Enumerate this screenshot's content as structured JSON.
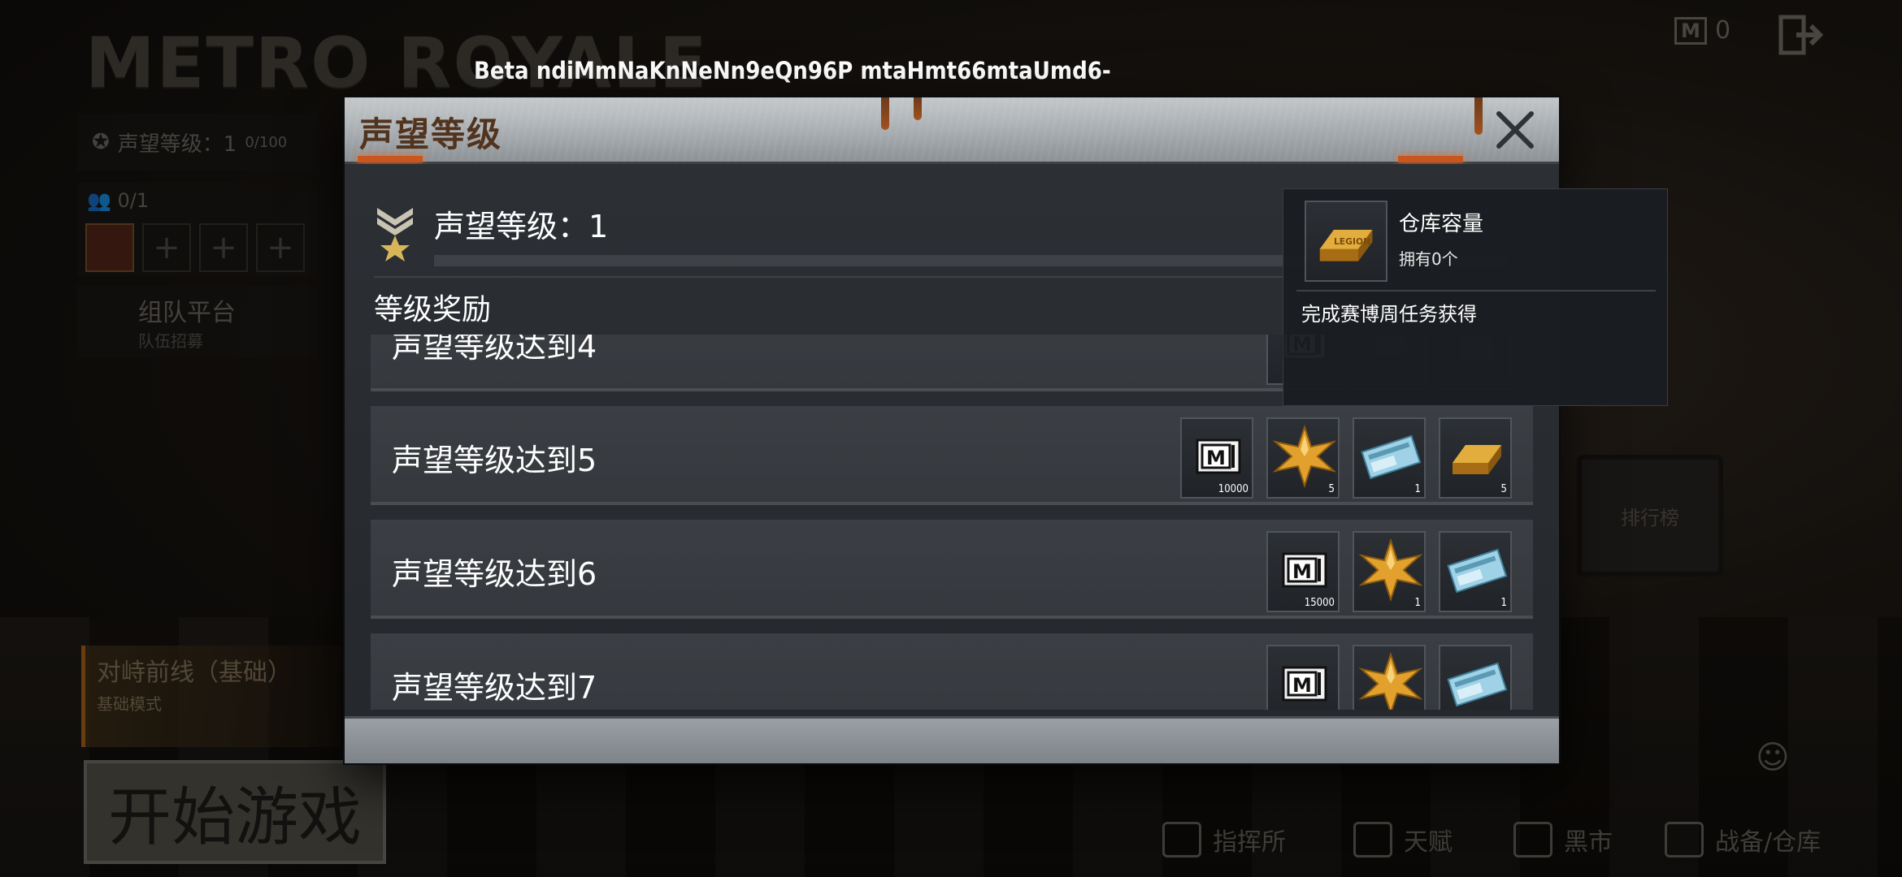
{
  "background": {
    "logo_text": "METRO ROYALE",
    "beta_text": "Beta ndiMmNaKnNeNn9eQn96P mtaHmt66mtaUmd6-",
    "currency_count": "0",
    "side": {
      "rank_label": "声望等级：1",
      "rank_progress": "0/100",
      "team_count": "0/1",
      "platform_title": "组队平台",
      "platform_sub": "队伍招募"
    },
    "mode": {
      "title": "对峙前线（基础）",
      "sub": "基础模式"
    },
    "start_label": "开始游戏",
    "tv_label": "排行榜",
    "nav": [
      {
        "label": "指挥所"
      },
      {
        "label": "天赋"
      },
      {
        "label": "黑市"
      },
      {
        "label": "战备/仓库"
      }
    ]
  },
  "dialog": {
    "title": "声望等级",
    "level_label": "声望等级：1",
    "level_progress_fraction": 0.0,
    "section_title": "等级奖励",
    "rewards": [
      {
        "label": "声望等级达到4",
        "items": [
          {
            "icon": "metro-cash-icon",
            "qty": ""
          },
          {
            "icon": "helmet-icon",
            "qty": ""
          },
          {
            "icon": "armor-icon",
            "qty": ""
          }
        ]
      },
      {
        "label": "声望等级达到5",
        "items": [
          {
            "icon": "metro-cash-icon",
            "qty": "10000"
          },
          {
            "icon": "gold-star-icon",
            "qty": "5"
          },
          {
            "icon": "ticket-icon",
            "qty": "1"
          },
          {
            "icon": "gold-bar-icon",
            "qty": "5"
          }
        ]
      },
      {
        "label": "声望等级达到6",
        "items": [
          {
            "icon": "metro-cash-icon",
            "qty": "15000"
          },
          {
            "icon": "gold-star-icon",
            "qty": "1"
          },
          {
            "icon": "ticket-icon",
            "qty": "1"
          }
        ]
      },
      {
        "label": "声望等级达到7",
        "items": [
          {
            "icon": "metro-cash-icon",
            "qty": ""
          },
          {
            "icon": "gold-star-icon",
            "qty": ""
          },
          {
            "icon": "ticket-icon",
            "qty": ""
          }
        ]
      }
    ]
  },
  "tooltip": {
    "icon": "gold-bar-icon",
    "name": "仓库容量",
    "owned": "拥有0个",
    "description": "完成赛博周任务获得"
  },
  "colors": {
    "accent_orange": "#c8561e",
    "gold": "#d9a032",
    "title_brown": "#51331e"
  }
}
